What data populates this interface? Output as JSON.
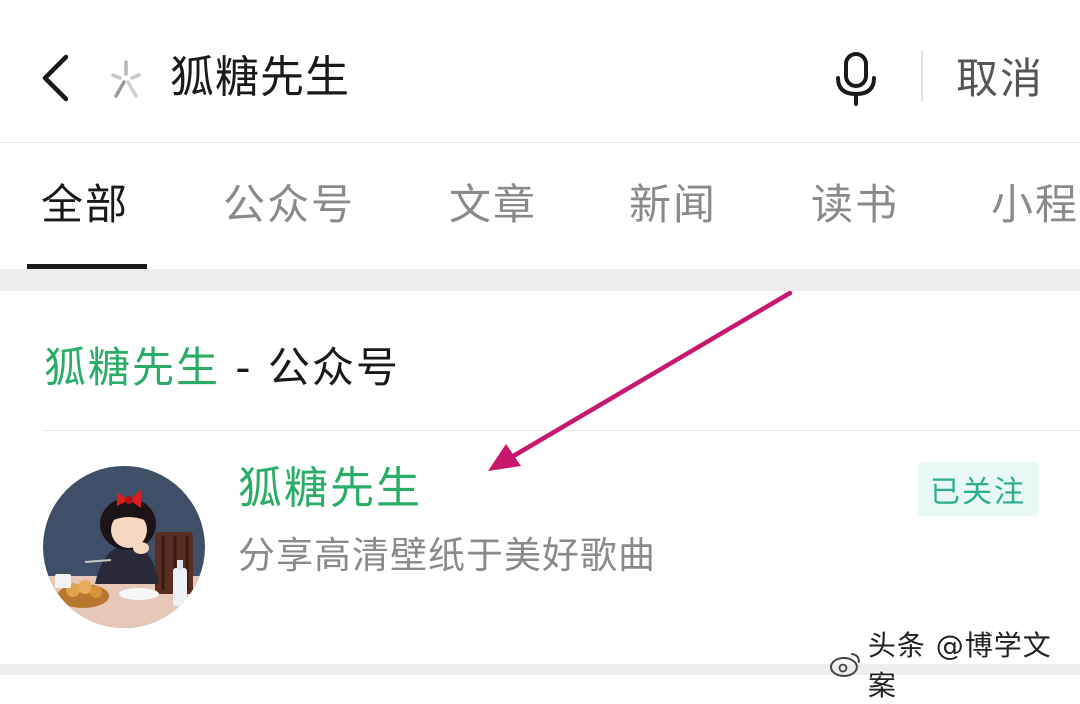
{
  "search": {
    "query": "狐糖先生",
    "cancel_label": "取消"
  },
  "tabs": [
    {
      "label": "全部"
    },
    {
      "label": "公众号"
    },
    {
      "label": "文章"
    },
    {
      "label": "新闻"
    },
    {
      "label": "读书"
    },
    {
      "label": "小程"
    }
  ],
  "active_tab": "全部",
  "result": {
    "section_name": "狐糖先生",
    "section_suffix": "- 公众号",
    "account_name": "狐糖先生",
    "account_desc": "分享高清壁纸于美好歌曲",
    "follow_status": "已关注"
  },
  "watermark": {
    "text": "头条 @博学文案"
  },
  "colors": {
    "accent_green": "#2aae67",
    "badge_bg": "#e8f8f4",
    "arrow": "#c8176e"
  },
  "icons": [
    "back-arrow-icon",
    "search-sparkle-icon",
    "microphone-icon",
    "weibo-icon"
  ]
}
